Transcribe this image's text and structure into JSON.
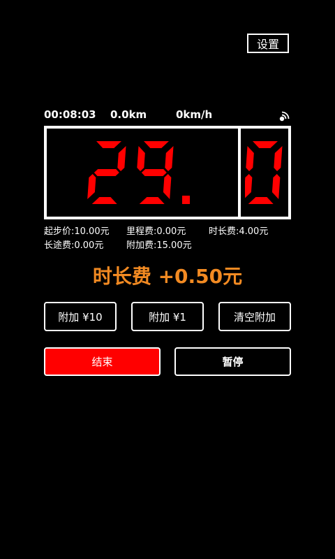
{
  "header": {
    "settings_label": "设置"
  },
  "status": {
    "elapsed": "00:08:03",
    "distance": "0.0km",
    "speed": "0km/h",
    "gps_icon": "signal-icon"
  },
  "meter": {
    "integer": "29",
    "decimal": "0",
    "digit_color": "#ff0000"
  },
  "fees": {
    "base": "起步价:10.00元",
    "mileage": "里程费:0.00元",
    "duration": "时长费:4.00元",
    "long_distance": "长途费:0.00元",
    "extra": "附加费:15.00元"
  },
  "notice": {
    "text": "时长费 +0.50元",
    "color": "#f28a22"
  },
  "buttons": {
    "add10": "附加 ¥10",
    "add1": "附加 ¥1",
    "clear": "清空附加",
    "end": "结束",
    "pause": "暂停"
  }
}
